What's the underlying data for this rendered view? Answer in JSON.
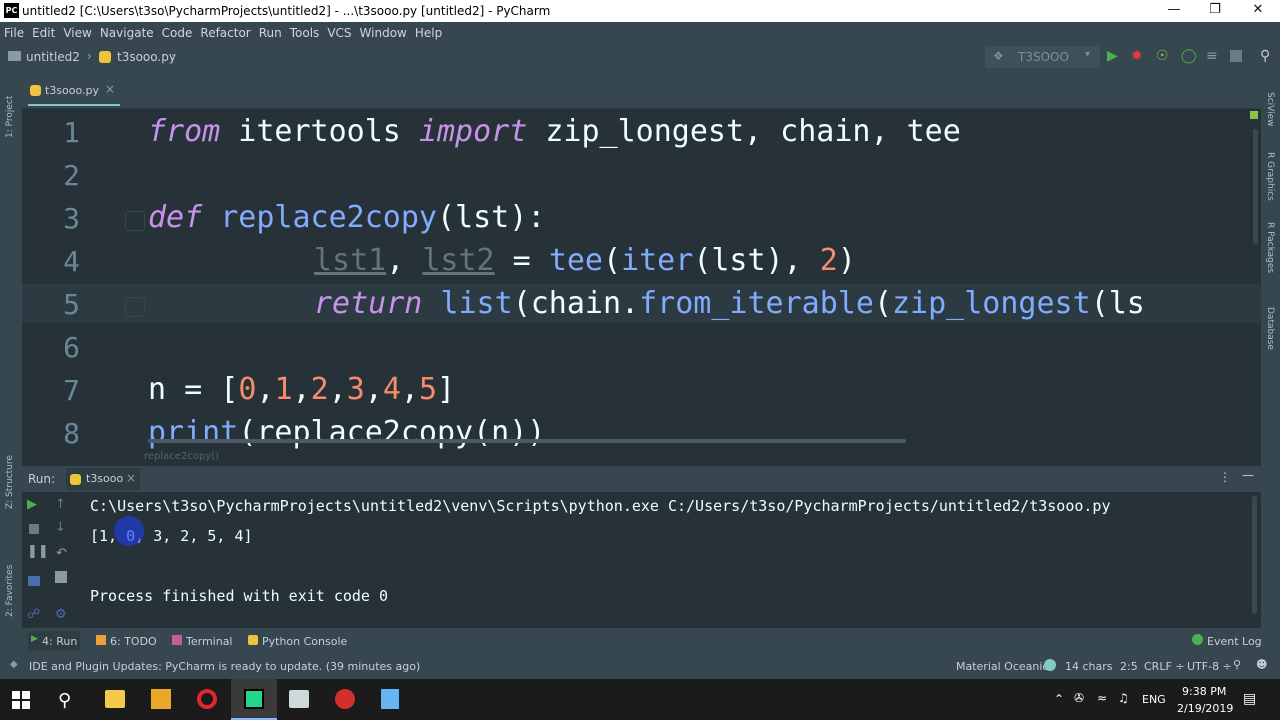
{
  "window": {
    "title": "untitled2 [C:\\Users\\t3so\\PycharmProjects\\untitled2] - ...\\t3sooo.py [untitled2] - PyCharm",
    "logo_text": "PC"
  },
  "menu": [
    "File",
    "Edit",
    "View",
    "Navigate",
    "Code",
    "Refactor",
    "Run",
    "Tools",
    "VCS",
    "Window",
    "Help"
  ],
  "nav": {
    "project": "untitled2",
    "file": "t3sooo.py",
    "run_config": "T3SOOO"
  },
  "side_tabs": {
    "project": "1: Project",
    "structure": "Z: Structure",
    "favorites": "2: Favorites",
    "sciview": "SciView",
    "r_graphics": "R Graphics",
    "r_packages": "R Packages",
    "database": "Database"
  },
  "editor_tab": {
    "label": "t3sooo.py",
    "close": "×"
  },
  "gutter": [
    "1",
    "2",
    "3",
    "4",
    "5",
    "6",
    "7",
    "8"
  ],
  "code": {
    "l1_a": "from",
    "l1_b": " itertools ",
    "l1_c": "import",
    "l1_d": " zip_longest, chain, tee",
    "l3_a": "def",
    "l3_b": " replace2copy",
    "l3_c": "(lst):",
    "l4_a": "lst1",
    "l4_b": ", ",
    "l4_c": "lst2",
    "l4_d": " = ",
    "l4_e": "tee",
    "l4_f": "(",
    "l4_g": "iter",
    "l4_h": "(lst), ",
    "l4_i": "2",
    "l4_j": ")",
    "l5_a": "return",
    "l5_b": " ",
    "l5_c": "list",
    "l5_d": "(chain.",
    "l5_e": "from_iterable",
    "l5_f": "(",
    "l5_g": "zip_longest",
    "l5_h": "(ls",
    "l7_a": "n = [",
    "l7_b": "0",
    "l7_c": ",",
    "l7_d": "1",
    "l7_e": ",",
    "l7_f": "2",
    "l7_g": ",",
    "l7_h": "3",
    "l7_i": ",",
    "l7_j": "4",
    "l7_k": ",",
    "l7_l": "5",
    "l7_m": "]",
    "l8_a": "print",
    "l8_b": "(replace2copy(n))"
  },
  "breadcrumb_hint": "replace2copy()",
  "run": {
    "label": "Run:",
    "tab": "t3sooo",
    "close": "×",
    "cmd_line": "C:\\Users\\t3so\\PycharmProjects\\untitled2\\venv\\Scripts\\python.exe C:/Users/t3so/PycharmProjects/untitled2/t3sooo.py",
    "output": "[1, 0, 3, 2, 5, 4]",
    "finish": "Process finished with exit code 0"
  },
  "tool_tabs": {
    "run": "4: Run",
    "todo": "6: TODO",
    "terminal": "Terminal",
    "python_console": "Python Console",
    "event_log": "Event Log"
  },
  "status": {
    "message": "IDE and Plugin Updates: PyCharm is ready to update. (39 minutes ago)",
    "theme": "Material Oceanic",
    "chars": "14 chars",
    "pos": "2:5",
    "line_sep": "CRLF ÷",
    "encoding": "UTF-8 ÷"
  },
  "taskbar": {
    "lang": "ENG",
    "time": "9:38 PM",
    "date": "2/19/2019"
  },
  "colors": {
    "keyword": "#c792ea",
    "function": "#82aaff",
    "number": "#f78c6c",
    "editor_bg": "#263238",
    "panel_bg": "#37474f"
  }
}
